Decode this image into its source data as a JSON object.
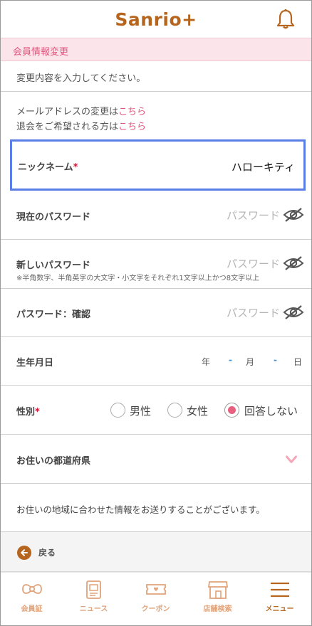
{
  "header": {
    "logo": "Sanrio+",
    "bell_icon": "bell-icon"
  },
  "section": {
    "title": "会員情報変更"
  },
  "intro": {
    "text": "変更内容を入力してください。"
  },
  "links": {
    "email_prefix": "メールアドレスの変更は",
    "email_link": "こちら",
    "withdraw_prefix": "退会をご希望される方は",
    "withdraw_link": "こちら"
  },
  "form": {
    "nickname": {
      "label": "ニックネーム",
      "required": "*",
      "value": "ハローキティ"
    },
    "current_password": {
      "label": "現在のパスワード",
      "placeholder": "パスワード"
    },
    "new_password": {
      "label": "新しいパスワード",
      "placeholder": "パスワード",
      "hint": "※半角数字、半角英字の大文字・小文字をそれぞれ1文字以上かつ8文字以上"
    },
    "confirm_password": {
      "label": "パスワード：確認",
      "placeholder": "パスワード"
    },
    "birthday": {
      "label": "生年月日",
      "year": "年",
      "month": "月",
      "day": "日",
      "dash": "-"
    },
    "gender": {
      "label": "性別",
      "required": "*",
      "options": [
        "男性",
        "女性",
        "回答しない"
      ],
      "selected": "回答しない"
    },
    "prefecture": {
      "label": "お住いの都道府県"
    }
  },
  "info": {
    "text": "お住いの地域に合わせた情報をお送りすることがございます。"
  },
  "back": {
    "label": "戻る"
  },
  "nav": {
    "items": [
      {
        "label": "会員証",
        "icon": "bow-icon"
      },
      {
        "label": "ニュース",
        "icon": "news-icon"
      },
      {
        "label": "クーポン",
        "icon": "coupon-icon"
      },
      {
        "label": "店舗検索",
        "icon": "store-icon"
      },
      {
        "label": "メニュー",
        "icon": "menu-icon"
      }
    ],
    "active": "メニュー"
  },
  "colors": {
    "brand": "#b5651d",
    "accent": "#e0567e",
    "focus": "#5a7de6"
  }
}
